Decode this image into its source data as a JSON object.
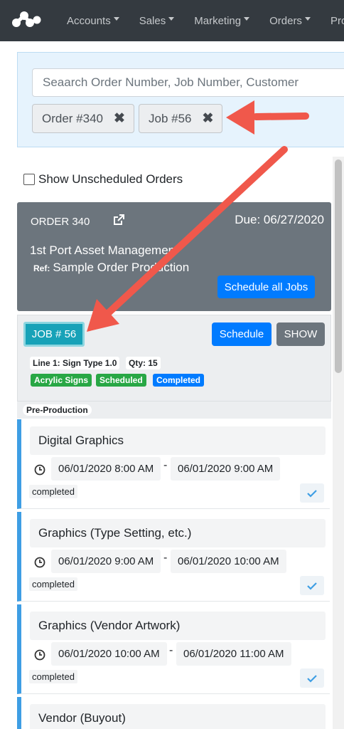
{
  "nav": {
    "items": [
      {
        "label": "Accounts"
      },
      {
        "label": "Sales"
      },
      {
        "label": "Marketing"
      },
      {
        "label": "Orders"
      },
      {
        "label": "Pro"
      }
    ]
  },
  "search": {
    "placeholder": "Seaarch Order Number, Job Number, Customer",
    "chips": [
      {
        "label": "Order #340"
      },
      {
        "label": "Job #56"
      }
    ]
  },
  "filters": {
    "show_unscheduled_label": "Show Unscheduled Orders"
  },
  "order": {
    "title": "ORDER 340",
    "due": "Due: 06/27/2020",
    "customer": "1st Port Asset Managemen",
    "ref_label": "Ref:",
    "ref_value": "Sample Order Production",
    "schedule_all_label": "Schedule all Jobs"
  },
  "job": {
    "badge": "JOB # 56",
    "schedule_label": "Schedule",
    "show_label": "SHOW",
    "line": "Line 1: Sign Type 1.0",
    "qty": "Qty: 15",
    "tags": [
      {
        "label": "Acrylic Signs",
        "color": "#28a745"
      },
      {
        "label": "Scheduled",
        "color": "#28a745"
      },
      {
        "label": "Completed",
        "color": "#007bff"
      }
    ]
  },
  "section": {
    "label": "Pre-Production"
  },
  "tasks": [
    {
      "title": "Digital Graphics",
      "start": "06/01/2020 8:00 AM",
      "end": "06/01/2020 9:00 AM",
      "status": "completed"
    },
    {
      "title": "Graphics (Type Setting, etc.)",
      "start": "06/01/2020 9:00 AM",
      "end": "06/01/2020 10:00 AM",
      "status": "completed"
    },
    {
      "title": "Graphics (Vendor Artwork)",
      "start": "06/01/2020 10:00 AM",
      "end": "06/01/2020 11:00 AM",
      "status": "completed"
    },
    {
      "title": "Vendor (Buyout)"
    }
  ],
  "colors": {
    "accent": "#007bff",
    "task_border": "#3e9ee4",
    "arrow": "#f0584b",
    "navbar": "#343a40"
  }
}
